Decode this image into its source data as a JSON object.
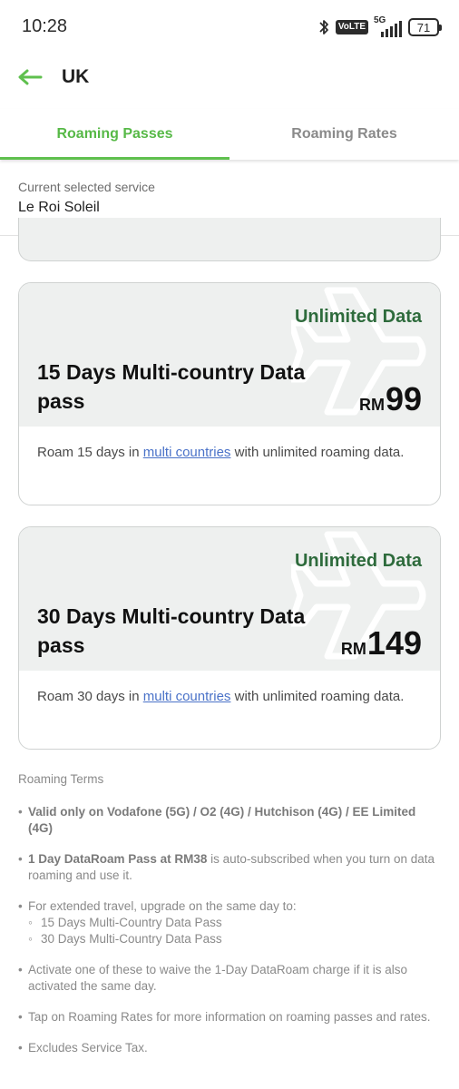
{
  "status_bar": {
    "time": "10:28",
    "volte": "VoLTE",
    "network": "5G",
    "battery": "71"
  },
  "header": {
    "title": "UK",
    "back_icon": "arrow-left-icon",
    "accent_color": "#5fc04e"
  },
  "tabs": [
    {
      "label": "Roaming Passes",
      "active": true
    },
    {
      "label": "Roaming Rates",
      "active": false
    }
  ],
  "service": {
    "caption": "Current selected service",
    "name": "Le Roi Soleil"
  },
  "cards": [
    {
      "tag": "Unlimited Data",
      "title": "15 Days Multi-country Data pass",
      "currency": "RM",
      "price": "99",
      "desc_before": "Roam 15 days in ",
      "desc_link": "multi countries",
      "desc_after": " with unlimited roaming data."
    },
    {
      "tag": "Unlimited Data",
      "title": "30 Days Multi-country Data pass",
      "currency": "RM",
      "price": "149",
      "desc_before": "Roam 30 days in ",
      "desc_link": "multi countries",
      "desc_after": " with unlimited roaming data."
    }
  ],
  "terms": {
    "title": "Roaming Terms",
    "t1": "Valid only on Vodafone (5G) / O2 (4G) / Hutchison (4G) / EE Limited (4G)",
    "t2_bold": "1 Day DataRoam Pass at RM38",
    "t2_rest": " is auto-subscribed when you turn on data roaming and use it.",
    "t3": "For extended travel, upgrade on the same day to:",
    "t3_sub1": "15 Days Multi-Country Data Pass",
    "t3_sub2": "30 Days Multi-Country Data Pass",
    "t4": "Activate one of these to waive the 1-Day DataRoam charge if it is also activated the same day.",
    "t5": "Tap on Roaming Rates for more information on roaming passes and rates.",
    "t6": "Excludes Service Tax."
  }
}
